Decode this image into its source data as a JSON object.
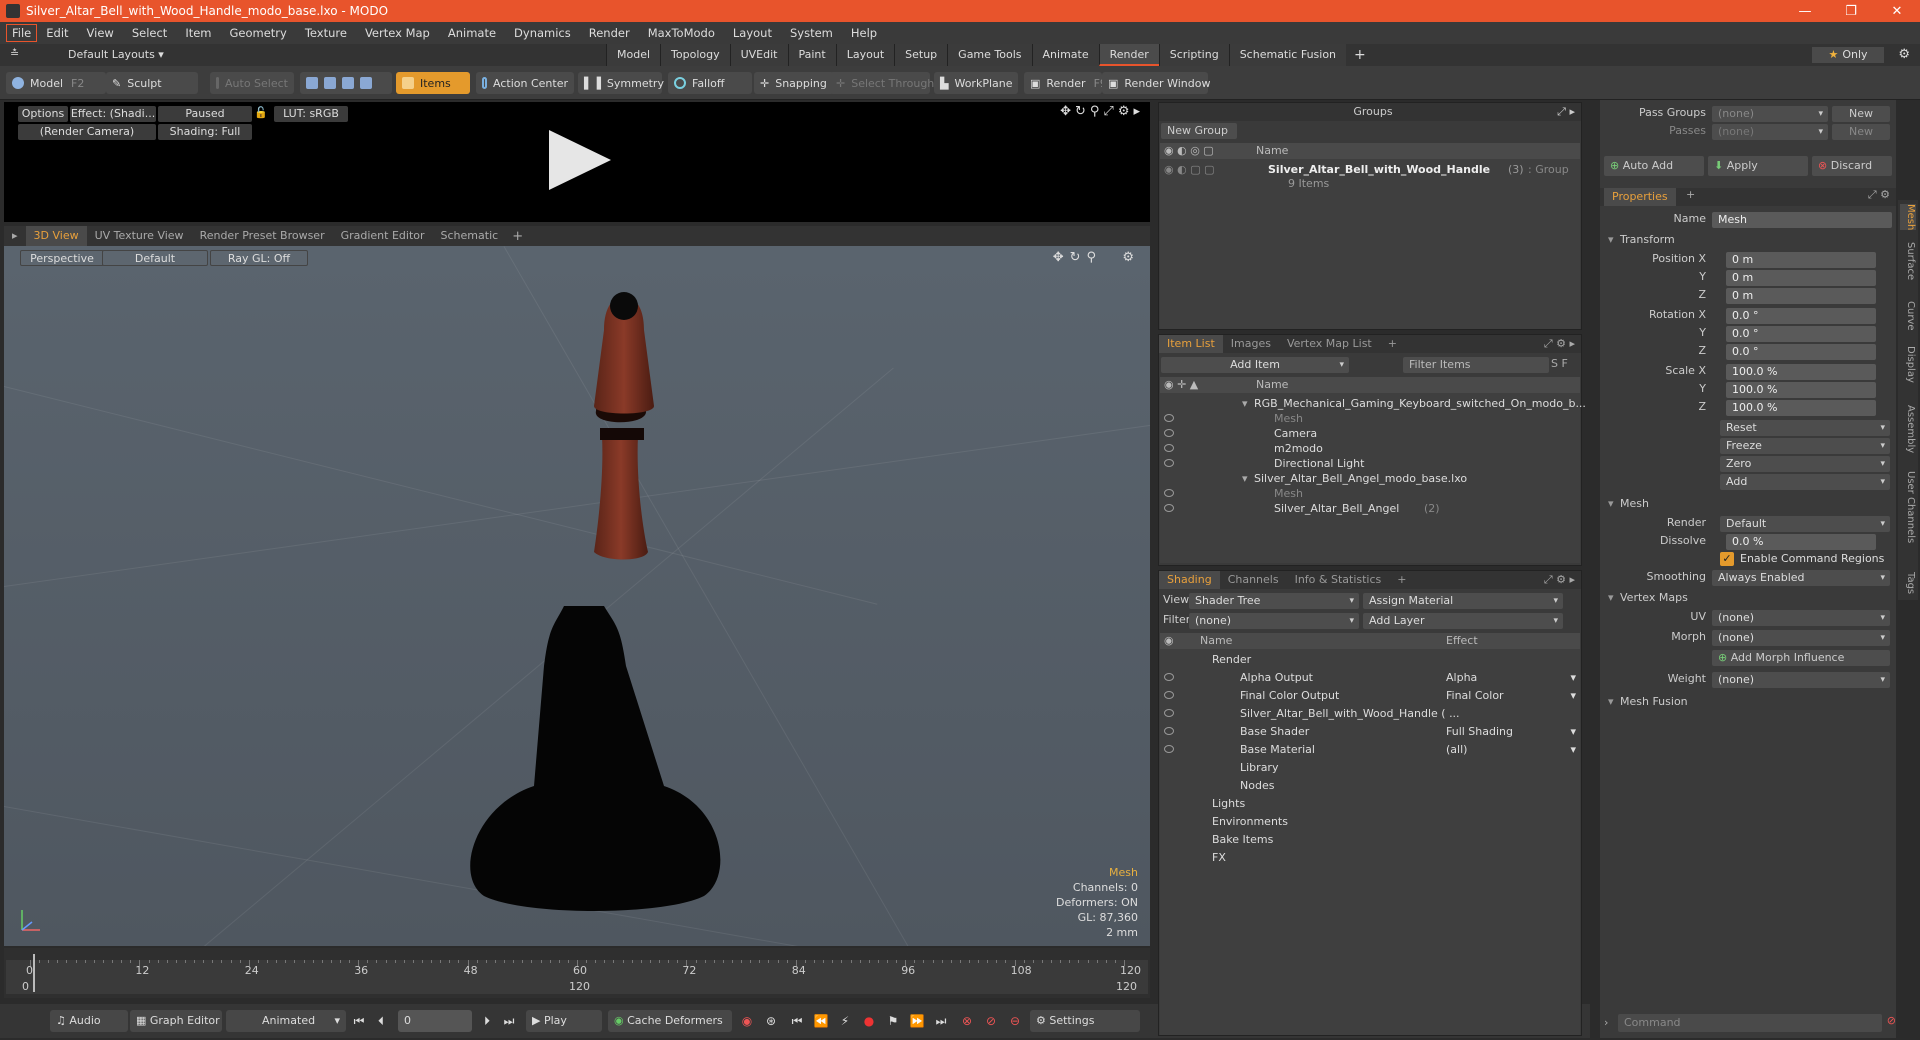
{
  "window": {
    "title": "Silver_Altar_Bell_with_Wood_Handle_modo_base.lxo - MODO",
    "min": "—",
    "max": "❐",
    "close": "✕"
  },
  "menu": [
    "File",
    "Edit",
    "View",
    "Select",
    "Item",
    "Geometry",
    "Texture",
    "Vertex Map",
    "Animate",
    "Dynamics",
    "Render",
    "MaxToModo",
    "Layout",
    "System",
    "Help"
  ],
  "layouts": {
    "selector": "Default Layouts ▾",
    "only": "Only",
    "tabs": [
      "Model",
      "Topology",
      "UVEdit",
      "Paint",
      "Layout",
      "Setup",
      "Game Tools",
      "Animate",
      "Render",
      "Scripting",
      "Schematic Fusion"
    ],
    "active_tab": "Render"
  },
  "toolbar": {
    "model": "Model",
    "model_key": "F2",
    "sculpt": "Sculpt",
    "auto_select": "Auto Select",
    "items": "Items",
    "action_center": "Action Center",
    "symmetry": "Symmetry",
    "falloff": "Falloff",
    "snapping": "Snapping",
    "select_through": "Select Through",
    "workplane": "WorkPlane",
    "render": "Render",
    "render_key": "F9",
    "render_window": "Render Window"
  },
  "render_panel": {
    "options": "Options",
    "effect": "Effect: (Shadi...",
    "paused": "Paused",
    "lut": "LUT: sRGB",
    "camera": "(Render Camera)",
    "shading": "Shading: Full"
  },
  "viewport_tabs": [
    "3D View",
    "UV Texture View",
    "Render Preset Browser",
    "Gradient Editor",
    "Schematic"
  ],
  "viewport": {
    "perspective": "Perspective",
    "default": "Default",
    "raygl": "Ray GL: Off",
    "info": {
      "title": "Mesh",
      "channels": "Channels: 0",
      "deformers": "Deformers: ON",
      "gl": "GL: 87,360",
      "size": "2 mm"
    }
  },
  "timeline": {
    "top_labels": [
      "0",
      "12",
      "24",
      "36",
      "48",
      "60",
      "72",
      "84",
      "96",
      "108",
      "120"
    ],
    "bottom_labels": [
      "0",
      "120",
      "120"
    ]
  },
  "bottombar": {
    "audio": "Audio",
    "graph_editor": "Graph Editor",
    "animated": "Animated",
    "frame": "0",
    "play": "Play",
    "cache_deformers": "Cache Deformers",
    "settings": "Settings"
  },
  "groups": {
    "title": "Groups",
    "new_group": "New Group",
    "col_name": "Name",
    "item_name": "Silver_Altar_Bell_with_Wood_Handle",
    "item_count": "(3)",
    "item_type": ": Group",
    "item_sub": "9 Items"
  },
  "item_list": {
    "tabs": [
      "Item List",
      "Images",
      "Vertex Map List"
    ],
    "add_item": "Add Item",
    "filter": "Filter Items",
    "col_name": "Name",
    "rows": [
      {
        "label": "RGB_Mechanical_Gaming_Keyboard_switched_On_modo_b...",
        "indent": 0
      },
      {
        "label": "Mesh",
        "indent": 1,
        "dim": true
      },
      {
        "label": "Camera",
        "indent": 1
      },
      {
        "label": "m2modo",
        "indent": 1
      },
      {
        "label": "Directional Light",
        "indent": 1
      },
      {
        "label": "Silver_Altar_Bell_Angel_modo_base.lxo",
        "indent": 0
      },
      {
        "label": "Mesh",
        "indent": 1,
        "dim": true
      },
      {
        "label": "Silver_Altar_Bell_Angel",
        "indent": 1,
        "suffix": "(2)"
      }
    ]
  },
  "shading": {
    "tabs": [
      "Shading",
      "Channels",
      "Info & Statistics"
    ],
    "view_label": "View",
    "view_value": "Shader Tree",
    "assign": "Assign Material",
    "filter_label": "Filter",
    "filter_value": "(none)",
    "add_layer": "Add Layer",
    "col_name": "Name",
    "col_effect": "Effect",
    "rows": [
      {
        "name": "Render",
        "effect": "",
        "indent": 0
      },
      {
        "name": "Alpha Output",
        "effect": "Alpha",
        "indent": 1
      },
      {
        "name": "Final Color Output",
        "effect": "Final Color",
        "indent": 1
      },
      {
        "name": "Silver_Altar_Bell_with_Wood_Handle ( ...",
        "effect": "",
        "indent": 1
      },
      {
        "name": "Base Shader",
        "effect": "Full Shading",
        "indent": 1
      },
      {
        "name": "Base Material",
        "effect": "(all)",
        "indent": 1
      },
      {
        "name": "Library",
        "effect": "",
        "indent": 1
      },
      {
        "name": "Nodes",
        "effect": "",
        "indent": 1
      },
      {
        "name": "Lights",
        "effect": "",
        "indent": 0
      },
      {
        "name": "Environments",
        "effect": "",
        "indent": 0
      },
      {
        "name": "Bake Items",
        "effect": "",
        "indent": 0
      },
      {
        "name": "FX",
        "effect": "",
        "indent": 0
      }
    ]
  },
  "properties": {
    "pass_groups": "Pass Groups",
    "passes": "Passes",
    "none": "(none)",
    "new": "New",
    "auto_add": "Auto Add",
    "apply": "Apply",
    "discard": "Discard",
    "tab": "Properties",
    "name_label": "Name",
    "name_value": "Mesh",
    "transform": "Transform",
    "pos_label": "Position X",
    "y": "Y",
    "z": "Z",
    "pos_x": "0 m",
    "pos_y": "0 m",
    "pos_z": "0 m",
    "rot_label": "Rotation X",
    "rot_x": "0.0 °",
    "rot_y": "0.0 °",
    "rot_z": "0.0 °",
    "scale_label": "Scale X",
    "scale_x": "100.0 %",
    "scale_y": "100.0 %",
    "scale_z": "100.0 %",
    "reset": "Reset",
    "freeze": "Freeze",
    "zero": "Zero",
    "add": "Add",
    "mesh": "Mesh",
    "render_label": "Render",
    "render_value": "Default",
    "dissolve_label": "Dissolve",
    "dissolve_value": "0.0 %",
    "cmd_regions": "Enable Command Regions",
    "smoothing_label": "Smoothing",
    "smoothing_value": "Always Enabled",
    "vertex_maps": "Vertex Maps",
    "uv_label": "UV",
    "morph_label": "Morph",
    "add_morph": "Add Morph Influence",
    "weight_label": "Weight",
    "mesh_fusion": "Mesh Fusion",
    "side_tabs": [
      "Mesh",
      "Surface",
      "Curve",
      "Display",
      "Assembly",
      "User Channels",
      "Tags"
    ],
    "command": "Command"
  }
}
